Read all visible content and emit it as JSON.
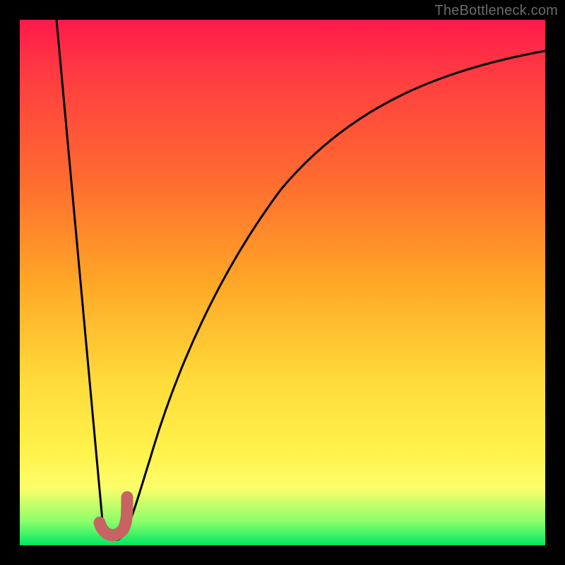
{
  "watermark": "TheBottleneck.com",
  "chart_data": {
    "type": "line",
    "title": "",
    "xlabel": "",
    "ylabel": "",
    "xlim": [
      0,
      100
    ],
    "ylim": [
      0,
      100
    ],
    "series": [
      {
        "name": "bottleneck-curve",
        "x": [
          7,
          10,
          13,
          15,
          17,
          18,
          19,
          20,
          22,
          25,
          30,
          35,
          40,
          50,
          60,
          70,
          80,
          90,
          100
        ],
        "y": [
          100,
          70,
          40,
          20,
          6,
          2,
          1,
          2,
          8,
          22,
          40,
          54,
          63,
          75,
          82,
          87,
          90,
          92,
          93
        ]
      }
    ],
    "marker": {
      "name": "highlight-j",
      "color": "#c86060",
      "points_x": [
        15.5,
        16.5,
        18.2,
        19.6,
        20.2,
        20.2
      ],
      "points_y": [
        3.5,
        1.6,
        1.4,
        2.3,
        5.0,
        9.0
      ]
    },
    "background": "heat-gradient-red-to-green"
  }
}
